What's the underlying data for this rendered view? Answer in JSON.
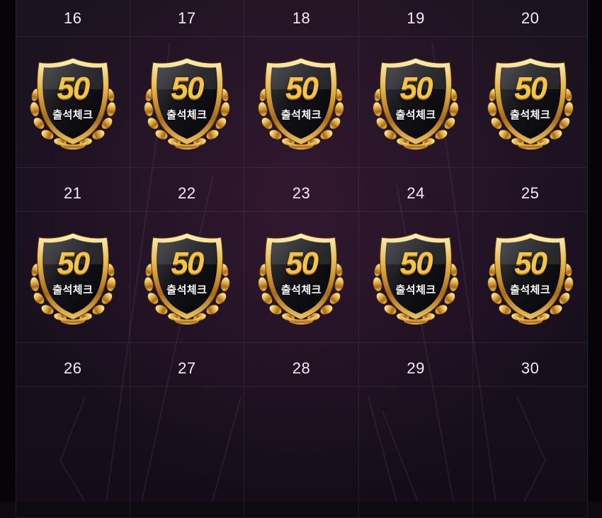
{
  "colors": {
    "background": "#1a1020",
    "gold": "#e8b64a",
    "shield": "#111015",
    "text": "#f2eef4"
  },
  "stamp": {
    "number": "50",
    "label": "출석체크",
    "icon": "gold-laurel-shield-icon"
  },
  "rows": [
    {
      "days": [
        "16",
        "17",
        "18",
        "19",
        "20"
      ],
      "stamped": [
        true,
        true,
        true,
        true,
        true
      ]
    },
    {
      "days": [
        "21",
        "22",
        "23",
        "24",
        "25"
      ],
      "stamped": [
        true,
        true,
        true,
        true,
        true
      ]
    },
    {
      "days": [
        "26",
        "27",
        "28",
        "29",
        "30"
      ],
      "stamped": [
        false,
        false,
        false,
        false,
        false
      ]
    }
  ]
}
